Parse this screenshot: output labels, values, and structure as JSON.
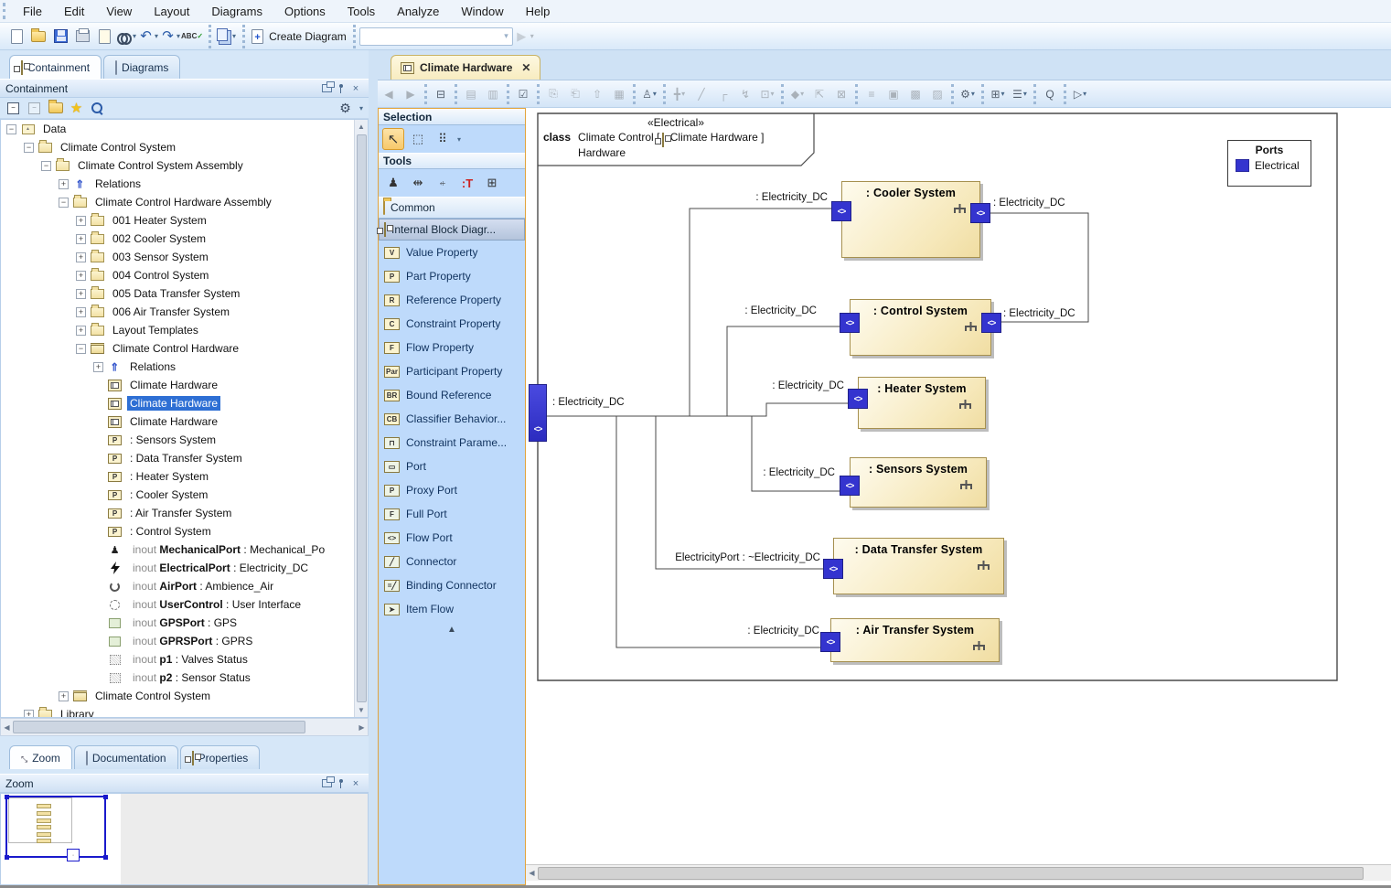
{
  "menu": {
    "items": [
      "File",
      "Edit",
      "View",
      "Layout",
      "Diagrams",
      "Options",
      "Tools",
      "Analyze",
      "Window",
      "Help"
    ]
  },
  "toolbar": {
    "create_diagram_label": "Create Diagram",
    "combo_value": "",
    "icons": [
      "new-file",
      "open-project",
      "save-project",
      "print",
      "print-preview",
      "find",
      "undo",
      "redo",
      "spell-check",
      "transfer-project",
      "create-diagram",
      "run"
    ]
  },
  "left_panel": {
    "tabs": [
      {
        "label": "Containment",
        "active": true
      },
      {
        "label": "Diagrams",
        "active": false
      }
    ],
    "header_title": "Containment",
    "toolbar_icons": [
      "collapse-all",
      "collapse-selected",
      "open-diagram",
      "favorites",
      "search",
      "settings"
    ],
    "tree": [
      {
        "depth": 0,
        "expander": "-",
        "icon": "model",
        "text": "Data"
      },
      {
        "depth": 1,
        "expander": "-",
        "icon": "pkg",
        "text": "Climate Control System"
      },
      {
        "depth": 2,
        "expander": "-",
        "icon": "pkg",
        "text": "Climate Control System Assembly"
      },
      {
        "depth": 3,
        "expander": "+",
        "icon": "rel",
        "text": "Relations"
      },
      {
        "depth": 3,
        "expander": "-",
        "icon": "pkg",
        "text": "Climate Control Hardware Assembly"
      },
      {
        "depth": 4,
        "expander": "+",
        "icon": "pkg",
        "text": "001 Heater System"
      },
      {
        "depth": 4,
        "expander": "+",
        "icon": "pkg",
        "text": "002 Cooler System"
      },
      {
        "depth": 4,
        "expander": "+",
        "icon": "pkg",
        "text": "003 Sensor System"
      },
      {
        "depth": 4,
        "expander": "+",
        "icon": "pkg",
        "text": "004 Control System"
      },
      {
        "depth": 4,
        "expander": "+",
        "icon": "pkg",
        "text": "005 Data Transfer System"
      },
      {
        "depth": 4,
        "expander": "+",
        "icon": "pkg",
        "text": "006 Air Transfer System"
      },
      {
        "depth": 4,
        "expander": "+",
        "icon": "pkg",
        "text": "Layout Templates"
      },
      {
        "depth": 4,
        "expander": "-",
        "icon": "block",
        "text": "Climate Control Hardware"
      },
      {
        "depth": 5,
        "expander": "+",
        "icon": "rel",
        "text": "Relations"
      },
      {
        "depth": 5,
        "expander": "",
        "icon": "ibd",
        "text": "Climate Hardware"
      },
      {
        "depth": 5,
        "expander": "",
        "icon": "ibd",
        "text": "Climate Hardware",
        "selected": true
      },
      {
        "depth": 5,
        "expander": "",
        "icon": "ibd",
        "text": "Climate Hardware"
      },
      {
        "depth": 5,
        "expander": "",
        "icon": "part",
        "text": ": Sensors System"
      },
      {
        "depth": 5,
        "expander": "",
        "icon": "part",
        "text": ": Data Transfer System"
      },
      {
        "depth": 5,
        "expander": "",
        "icon": "part",
        "text": ": Heater System"
      },
      {
        "depth": 5,
        "expander": "",
        "icon": "part",
        "text": ": Cooler System"
      },
      {
        "depth": 5,
        "expander": "",
        "icon": "part",
        "text": ": Air Transfer System"
      },
      {
        "depth": 5,
        "expander": "",
        "icon": "part",
        "text": ": Control System"
      },
      {
        "depth": 5,
        "expander": "",
        "icon": "mech",
        "prefix": "inout",
        "bold": "MechanicalPort",
        "text": " : Mechanical_Po"
      },
      {
        "depth": 5,
        "expander": "",
        "icon": "elec",
        "prefix": "inout",
        "bold": "ElectricalPort",
        "text": " : Electricity_DC"
      },
      {
        "depth": 5,
        "expander": "",
        "icon": "air",
        "prefix": "inout",
        "bold": "AirPort",
        "text": " : Ambience_Air"
      },
      {
        "depth": 5,
        "expander": "",
        "icon": "user",
        "prefix": "inout",
        "bold": "UserControl",
        "text": " : User Interface"
      },
      {
        "depth": 5,
        "expander": "",
        "icon": "gps",
        "prefix": "inout",
        "bold": "GPSPort",
        "text": " : GPS"
      },
      {
        "depth": 5,
        "expander": "",
        "icon": "gps",
        "prefix": "inout",
        "bold": "GPRSPort",
        "text": " : GPRS"
      },
      {
        "depth": 5,
        "expander": "",
        "icon": "dot",
        "prefix": "inout",
        "bold": "p1",
        "text": " : Valves Status"
      },
      {
        "depth": 5,
        "expander": "",
        "icon": "dot",
        "prefix": "inout",
        "bold": "p2",
        "text": " : Sensor Status"
      },
      {
        "depth": 3,
        "expander": "+",
        "icon": "block",
        "text": "Climate Control System"
      },
      {
        "depth": 1,
        "expander": "+",
        "icon": "pkg",
        "text": "Library"
      }
    ]
  },
  "bottom_panel": {
    "tabs": [
      {
        "label": "Zoom",
        "active": true
      },
      {
        "label": "Documentation",
        "active": false
      },
      {
        "label": "Properties",
        "active": false
      }
    ],
    "header_title": "Zoom"
  },
  "palette": {
    "selection_header": "Selection",
    "tools_header": "Tools",
    "drawers": [
      {
        "label": "Common",
        "selected": false
      },
      {
        "label": "Internal Block Diagr...",
        "selected": true
      }
    ],
    "items": [
      {
        "label": "Value Property",
        "badge": "V"
      },
      {
        "label": "Part Property",
        "badge": "P"
      },
      {
        "label": "Reference Property",
        "badge": "R"
      },
      {
        "label": "Constraint Property",
        "badge": "C"
      },
      {
        "label": "Flow Property",
        "badge": "F"
      },
      {
        "label": "Participant Property",
        "badge": "Par"
      },
      {
        "label": "Bound Reference",
        "badge": "BR"
      },
      {
        "label": "Classifier Behavior...",
        "badge": "CB"
      },
      {
        "label": "Constraint Parame...",
        "badge": "⊓",
        "shape": true
      },
      {
        "label": "Port",
        "badge": "▭",
        "shape": true
      },
      {
        "label": "Proxy Port",
        "badge": "P",
        "shape": true
      },
      {
        "label": "Full Port",
        "badge": "F",
        "shape": true
      },
      {
        "label": "Flow Port",
        "badge": "<>",
        "shape": true
      },
      {
        "label": "Connector",
        "badge": "╱",
        "shape": true
      },
      {
        "label": "Binding Connector",
        "badge": "=╱",
        "shape": true
      },
      {
        "label": "Item Flow",
        "badge": "➤",
        "shape": true
      }
    ]
  },
  "diagram": {
    "tab_label": "Climate Hardware",
    "frame_header": {
      "stereotype": "«Electrical»",
      "keyword": "class",
      "line1_left": "Climate Control [",
      "line1_right": "Climate Hardware ]",
      "line2": "Hardware"
    },
    "legend": {
      "title": "Ports",
      "entries": [
        {
          "label": "Electrical",
          "color": "#3434cf"
        }
      ]
    },
    "frame_port_label": ": Electricity_DC",
    "blocks": [
      {
        "id": "cooler",
        "title": ": Cooler System",
        "left_label": ": Electricity_DC",
        "right_label": ": Electricity_DC"
      },
      {
        "id": "control",
        "title": ": Control System",
        "left_label": ": Electricity_DC",
        "right_label": ": Electricity_DC"
      },
      {
        "id": "heater",
        "title": ": Heater System",
        "left_label": ": Electricity_DC"
      },
      {
        "id": "sensors",
        "title": ": Sensors System",
        "left_label": ": Electricity_DC"
      },
      {
        "id": "data",
        "title": ": Data Transfer System",
        "left_label": "ElectricityPort : ~Electricity_DC"
      },
      {
        "id": "air",
        "title": ": Air Transfer System",
        "left_label": ": Electricity_DC"
      }
    ]
  },
  "colors": {
    "port_blue": "#3434cf",
    "selection_blue": "#2e6fd4",
    "block_border": "#a6904f",
    "block_fill": "#f6e8ba",
    "palette_bg": "#bedafb",
    "chrome_bg": "#d6e7f8",
    "diagram_tab_bg": "#f8ecc0"
  }
}
